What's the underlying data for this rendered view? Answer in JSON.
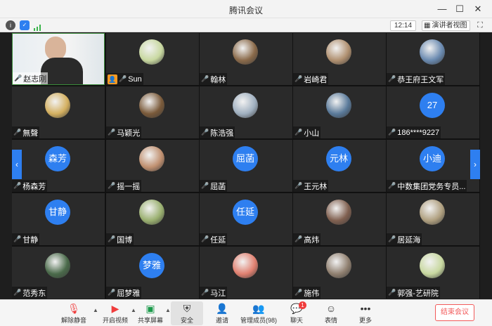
{
  "window": {
    "title": "腾讯会议",
    "min_icon": "minimize-icon",
    "max_icon": "maximize-icon",
    "close_icon": "close-icon"
  },
  "infobar": {
    "time": "12:14",
    "view_label": "演讲者视图"
  },
  "participants": [
    {
      "name": "赵志刚",
      "type": "video",
      "muted": false
    },
    {
      "name": "Sun",
      "type": "photo",
      "muted": true,
      "host": true
    },
    {
      "name": "翰林",
      "type": "photo",
      "muted": true
    },
    {
      "name": "岩崎君",
      "type": "photo",
      "muted": true
    },
    {
      "name": "恭王府王文军",
      "type": "photo",
      "muted": true
    },
    {
      "name": "無聲",
      "type": "photo",
      "muted": true
    },
    {
      "name": "马颖光",
      "type": "photo",
      "muted": true
    },
    {
      "name": "陈浩强",
      "type": "photo",
      "muted": true
    },
    {
      "name": "小山",
      "type": "photo",
      "muted": true
    },
    {
      "name": "186****9227",
      "type": "text",
      "avatar_text": "27",
      "muted": false
    },
    {
      "name": "杨森芳",
      "type": "text",
      "avatar_text": "森芳",
      "muted": true
    },
    {
      "name": "摇一摇",
      "type": "photo",
      "muted": true
    },
    {
      "name": "屈菡",
      "type": "text",
      "avatar_text": "屈菡",
      "muted": true
    },
    {
      "name": "王元林",
      "type": "text",
      "avatar_text": "元林",
      "muted": true
    },
    {
      "name": "中数集团党务专员...",
      "type": "text",
      "avatar_text": "小迪",
      "muted": true
    },
    {
      "name": "甘静",
      "type": "text",
      "avatar_text": "甘静",
      "muted": true
    },
    {
      "name": "国博",
      "type": "photo",
      "muted": true
    },
    {
      "name": "任延",
      "type": "text",
      "avatar_text": "任延",
      "muted": true
    },
    {
      "name": "高炜",
      "type": "photo",
      "muted": true
    },
    {
      "name": "居延海",
      "type": "photo",
      "muted": true
    },
    {
      "name": "范秀东",
      "type": "photo",
      "muted": true
    },
    {
      "name": "屈梦雅",
      "type": "text",
      "avatar_text": "梦雅",
      "muted": false
    },
    {
      "name": "马江",
      "type": "photo",
      "muted": true
    },
    {
      "name": "施伟",
      "type": "photo",
      "muted": true
    },
    {
      "name": "郭强-艺研院",
      "type": "photo",
      "muted": true
    }
  ],
  "toolbar": {
    "unmute": "解除静音",
    "video": "开启视频",
    "share": "共享屏幕",
    "security": "安全",
    "invite": "邀请",
    "members": "管理成员(98)",
    "chat": "聊天",
    "chat_badge": "1",
    "reactions": "表情",
    "more": "更多",
    "end": "结束会议"
  },
  "colors": {
    "avatar_blue": "#2e7ff0",
    "end_red": "#f25a5a",
    "mute_red": "#ff5a4a"
  }
}
